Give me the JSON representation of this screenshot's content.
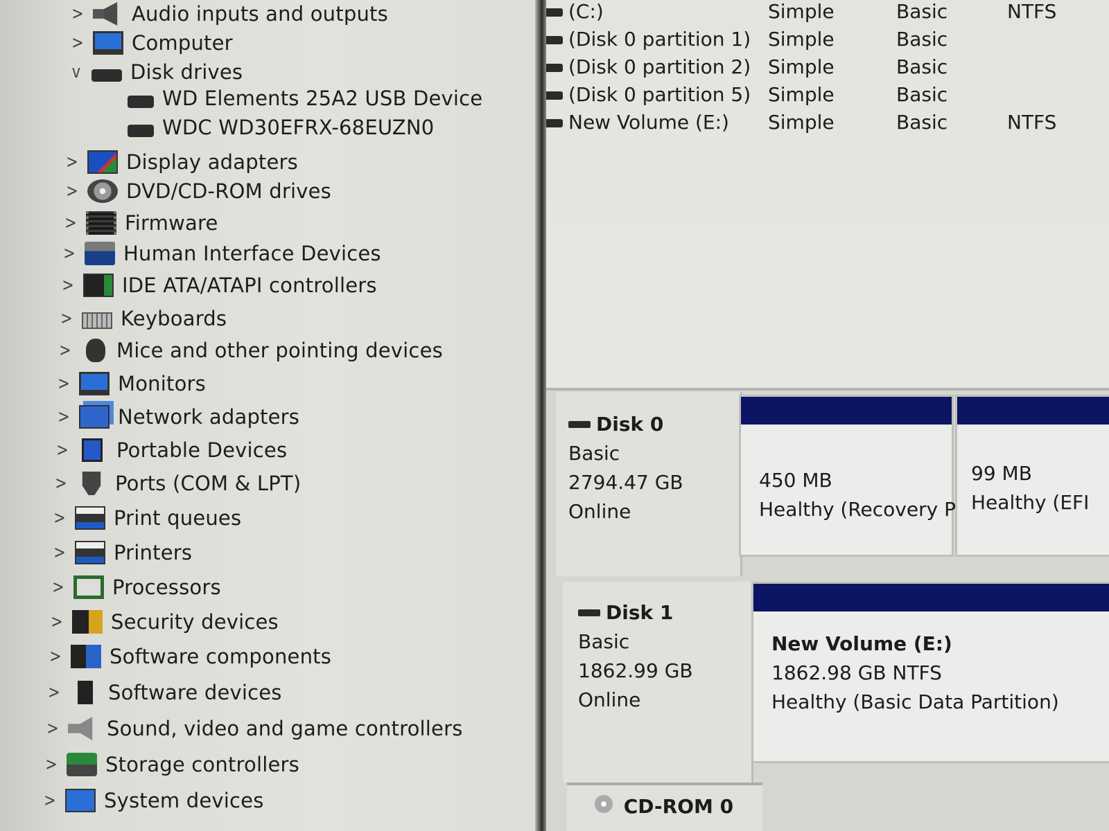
{
  "device_tree": {
    "items": [
      {
        "label": "Audio inputs and outputs",
        "chev": ">",
        "icon": "speaker-icon"
      },
      {
        "label": "Computer",
        "chev": ">",
        "icon": "computer-icon"
      },
      {
        "label": "Disk drives",
        "chev": "v",
        "icon": "disk-drive-icon"
      },
      {
        "label": "WD Elements 25A2 USB Device",
        "child": true,
        "icon": "disk-drive-icon"
      },
      {
        "label": "WDC WD30EFRX-68EUZN0",
        "child": true,
        "icon": "disk-drive-icon"
      },
      {
        "label": "Display adapters",
        "chev": ">",
        "icon": "display-adapter-icon"
      },
      {
        "label": "DVD/CD-ROM drives",
        "chev": ">",
        "icon": "dvd-icon"
      },
      {
        "label": "Firmware",
        "chev": ">",
        "icon": "firmware-icon"
      },
      {
        "label": "Human Interface Devices",
        "chev": ">",
        "icon": "hid-icon"
      },
      {
        "label": "IDE ATA/ATAPI controllers",
        "chev": ">",
        "icon": "ide-controller-icon"
      },
      {
        "label": "Keyboards",
        "chev": ">",
        "icon": "keyboard-icon"
      },
      {
        "label": "Mice and other pointing devices",
        "chev": ">",
        "icon": "mouse-icon"
      },
      {
        "label": "Monitors",
        "chev": ">",
        "icon": "monitor-icon"
      },
      {
        "label": "Network adapters",
        "chev": ">",
        "icon": "network-adapter-icon"
      },
      {
        "label": "Portable Devices",
        "chev": ">",
        "icon": "portable-device-icon"
      },
      {
        "label": "Ports (COM & LPT)",
        "chev": ">",
        "icon": "port-icon"
      },
      {
        "label": "Print queues",
        "chev": ">",
        "icon": "print-queue-icon"
      },
      {
        "label": "Printers",
        "chev": ">",
        "icon": "printer-icon"
      },
      {
        "label": "Processors",
        "chev": ">",
        "icon": "processor-icon"
      },
      {
        "label": "Security devices",
        "chev": ">",
        "icon": "security-device-icon"
      },
      {
        "label": "Software components",
        "chev": ">",
        "icon": "software-component-icon"
      },
      {
        "label": "Software devices",
        "chev": ">",
        "icon": "software-device-icon"
      },
      {
        "label": "Sound, video and game controllers",
        "chev": ">",
        "icon": "sound-icon"
      },
      {
        "label": "Storage controllers",
        "chev": ">",
        "icon": "storage-controller-icon"
      },
      {
        "label": "System devices",
        "chev": ">",
        "icon": "system-device-icon"
      }
    ]
  },
  "volume_list": {
    "rows": [
      {
        "name": "(C:)",
        "layout": "Simple",
        "type": "Basic",
        "fs": "NTFS"
      },
      {
        "name": "(Disk 0 partition 1)",
        "layout": "Simple",
        "type": "Basic",
        "fs": ""
      },
      {
        "name": "(Disk 0 partition 2)",
        "layout": "Simple",
        "type": "Basic",
        "fs": ""
      },
      {
        "name": "(Disk 0 partition 5)",
        "layout": "Simple",
        "type": "Basic",
        "fs": ""
      },
      {
        "name": "New Volume (E:)",
        "layout": "Simple",
        "type": "Basic",
        "fs": "NTFS"
      }
    ]
  },
  "disk0": {
    "title": "Disk 0",
    "type": "Basic",
    "size": "2794.47 GB",
    "status": "Online",
    "partitions": [
      {
        "size": "450 MB",
        "status": "Healthy (Recovery P"
      },
      {
        "size": "99 MB",
        "status": "Healthy (EFI"
      }
    ]
  },
  "disk1": {
    "title": "Disk 1",
    "type": "Basic",
    "size": "1862.99 GB",
    "status": "Online",
    "partition": {
      "name": "New Volume  (E:)",
      "size": "1862.98 GB NTFS",
      "status": "Healthy (Basic Data Partition)"
    }
  },
  "cdrom": {
    "title": "CD-ROM 0"
  },
  "colors": {
    "partition_bar": "#0c1464"
  }
}
